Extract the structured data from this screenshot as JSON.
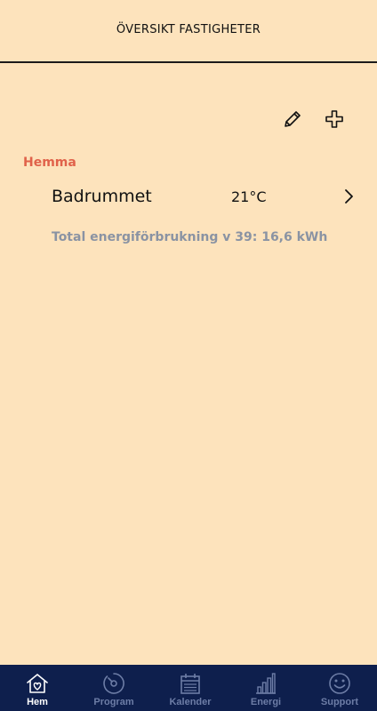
{
  "header": {
    "title": "ÖVERSIKT FASTIGHETER"
  },
  "toolbar": {
    "edit_icon": "pencil-icon",
    "add_icon": "plus-icon"
  },
  "group": {
    "label": "Hemma",
    "rooms": [
      {
        "name": "Badrummet",
        "temperature": "21°C"
      }
    ],
    "energy_summary": "Total energiförbrukning v 39: 16,6 kWh"
  },
  "tabbar": {
    "active": "Hem",
    "tabs": [
      {
        "label": "Hem",
        "icon": "home-heart-icon"
      },
      {
        "label": "Program",
        "icon": "dial-icon"
      },
      {
        "label": "Kalender",
        "icon": "calendar-icon"
      },
      {
        "label": "Energi",
        "icon": "bar-chart-icon"
      },
      {
        "label": "Support",
        "icon": "smiley-icon"
      }
    ]
  },
  "colors": {
    "background": "#fde3bc",
    "accent": "#e0624a",
    "tabbar": "#0e1f4d",
    "muted_text": "#8a93a3"
  }
}
